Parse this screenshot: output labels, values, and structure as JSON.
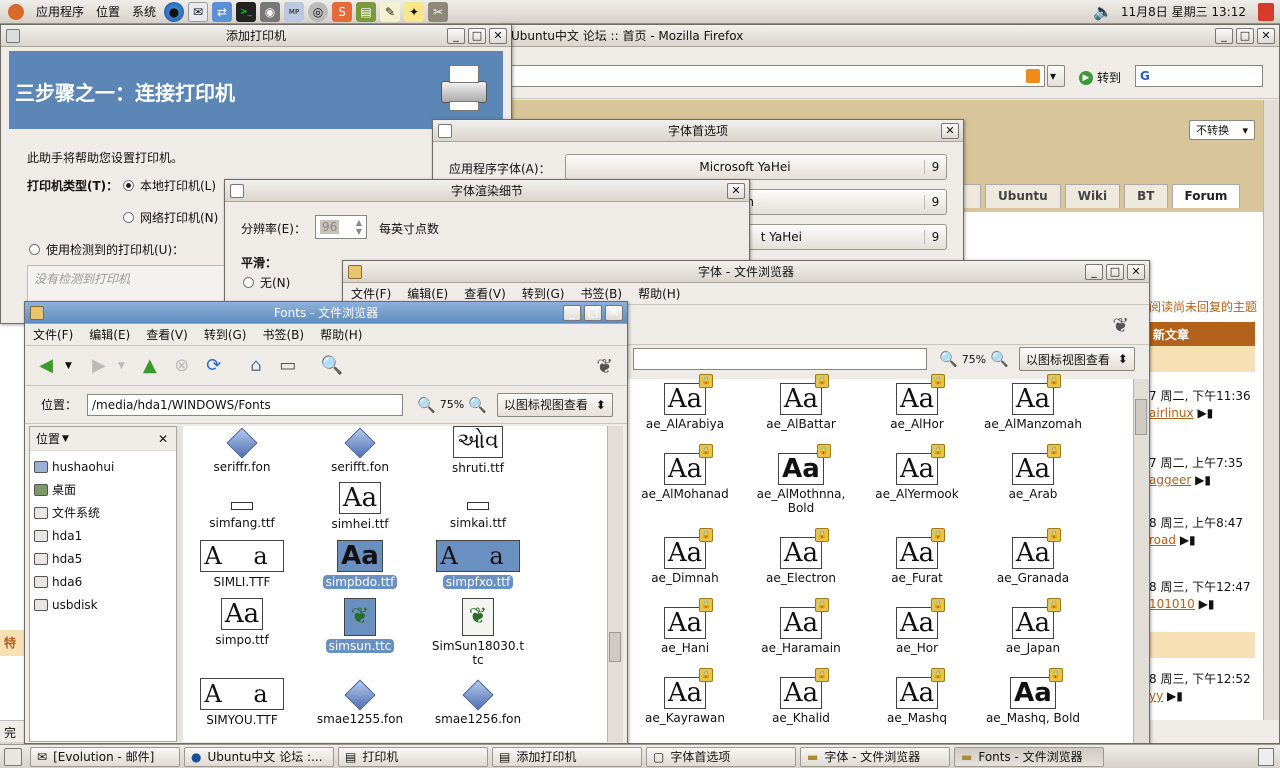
{
  "top_panel": {
    "menus": [
      "应用程序",
      "位置",
      "系统"
    ],
    "clock": "11月8日 星期三 13:12"
  },
  "firefox": {
    "title": "Ubuntu中文 论坛 :: 首页 - Mozilla Firefox",
    "go_label": "转到",
    "encoding": "不转换",
    "tabs": [
      "Ubuntu",
      "Wiki",
      "BT",
      "Forum"
    ],
    "side_header": "新文章",
    "side_link": "阅读尚未回复的主题",
    "posts": [
      {
        "time": "7 周二, 下午11:36",
        "user": "airlinux"
      },
      {
        "time": "7 周二, 上午7:35",
        "user": "aggeer"
      },
      {
        "time": "8 周三, 上午8:47",
        "user": "road"
      },
      {
        "time": "8 周三, 下午12:47",
        "user": "101010"
      },
      {
        "time": "8 周三, 下午12:52",
        "user": "yy"
      }
    ],
    "status_left": "完成",
    "left_mark": "特"
  },
  "add_printer": {
    "title": "添加打印机",
    "banner": "三步骤之一：连接打印机",
    "intro": "此助手将帮助您设置打印机。",
    "type_label": "打印机类型(T)：",
    "local": "本地打印机(L)",
    "network": "网络打印机(N)",
    "detected": "使用检测到的打印机(U)：",
    "no_detected": "没有检测到打印机"
  },
  "font_prefs": {
    "title": "字体首选项",
    "app_font_label": "应用程序字体(A)：",
    "fonts": [
      {
        "name": "Microsoft YaHei",
        "size": "9"
      },
      {
        "name": "un",
        "size": "9"
      },
      {
        "name": "t YaHei",
        "size": "9"
      }
    ]
  },
  "render_details": {
    "title": "字体渲染细节",
    "dpi_label": "分辨率(E)：",
    "dpi_value": "96",
    "dpi_unit": "每英寸点数",
    "smooth_label": "平滑：",
    "none_label": "无(N)"
  },
  "nautilus_back": {
    "title": "字体 - 文件浏览器",
    "menus": [
      "文件(F)",
      "编辑(E)",
      "查看(V)",
      "转到(G)",
      "书签(B)",
      "帮助(H)"
    ],
    "zoom": "75%",
    "view_mode": "以图标视图查看",
    "fonts": [
      [
        "ae_AlArabiya",
        "ae_AlBattar",
        "ae_AlHor",
        "ae_AlManzomah"
      ],
      [
        "ae_AlMohanad",
        "ae_AlMothnna, Bold",
        "ae_AlYermook",
        "ae_Arab"
      ],
      [
        "ae_Dimnah",
        "ae_Electron",
        "ae_Furat",
        "ae_Granada"
      ],
      [
        "ae_Hani",
        "ae_Haramain",
        "ae_Hor",
        "ae_Japan"
      ],
      [
        "ae_Kayrawan",
        "ae_Khalid",
        "ae_Mashq",
        "ae_Mashq, Bold"
      ]
    ]
  },
  "nautilus_front": {
    "title": "Fonts - 文件浏览器",
    "menus": [
      "文件(F)",
      "编辑(E)",
      "查看(V)",
      "转到(G)",
      "书签(B)",
      "帮助(H)"
    ],
    "location_label": "位置：",
    "location_value": "/media/hda1/WINDOWS/Fonts",
    "zoom": "75%",
    "view_mode": "以图标视图查看",
    "side_title": "位置",
    "places": [
      "hushaohui",
      "桌面",
      "文件系统",
      "hda1",
      "hda5",
      "hda6",
      "usbdisk"
    ],
    "files": [
      [
        "seriffr.fon",
        "serifft.fon",
        "shruti.ttf"
      ],
      [
        "simfang.ttf",
        "simhei.ttf",
        "simkai.ttf"
      ],
      [
        "SIMLI.TTF",
        "simpbdo.ttf",
        "simpfxo.ttf"
      ],
      [
        "simpo.ttf",
        "simsun.ttc",
        "SimSun18030.ttc"
      ],
      [
        "SIMYOU.TTF",
        "smae1255.fon",
        "smae1256.fon"
      ]
    ],
    "shruti_glyph": "ઓવ"
  },
  "taskbar": [
    "[Evolution - 邮件]",
    "Ubuntu中文 论坛 :...",
    "打印机",
    "添加打印机",
    "字体首选项",
    "字体 - 文件浏览器",
    "Fonts - 文件浏览器"
  ]
}
